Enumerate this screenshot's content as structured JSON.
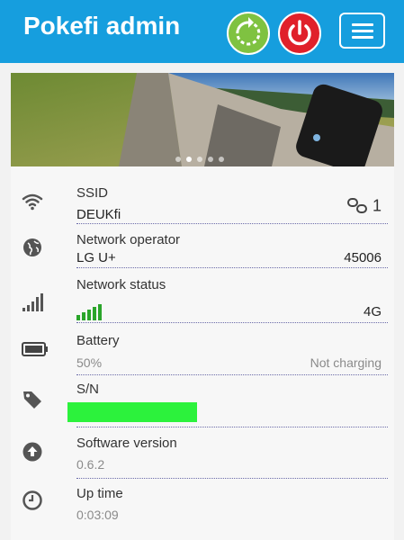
{
  "header": {
    "title": "Pokefi admin",
    "refresh_icon": "refresh-icon",
    "power_icon": "power-icon",
    "menu_icon": "hamburger-menu-icon",
    "color": "#169ede"
  },
  "banner": {
    "slides": 5,
    "active_slide": 2
  },
  "info": {
    "ssid": {
      "label": "SSID",
      "value": "DEUKfi",
      "clients": "1",
      "icon": "wifi-icon"
    },
    "operator": {
      "label": "Network operator",
      "value": "LG U+",
      "code": "45006",
      "icon": "globe-icon"
    },
    "network": {
      "label": "Network status",
      "value": "4G",
      "icon": "signal-icon"
    },
    "battery": {
      "label": "Battery",
      "value": "50%",
      "status": "Not charging",
      "icon": "battery-icon"
    },
    "sn": {
      "label": "S/N",
      "icon": "tag-icon"
    },
    "software": {
      "label": "Software version",
      "value": "0.6.2",
      "icon": "upload-circle-icon"
    },
    "uptime": {
      "label": "Up time",
      "value": "0:03:09",
      "icon": "clock-icon"
    }
  }
}
